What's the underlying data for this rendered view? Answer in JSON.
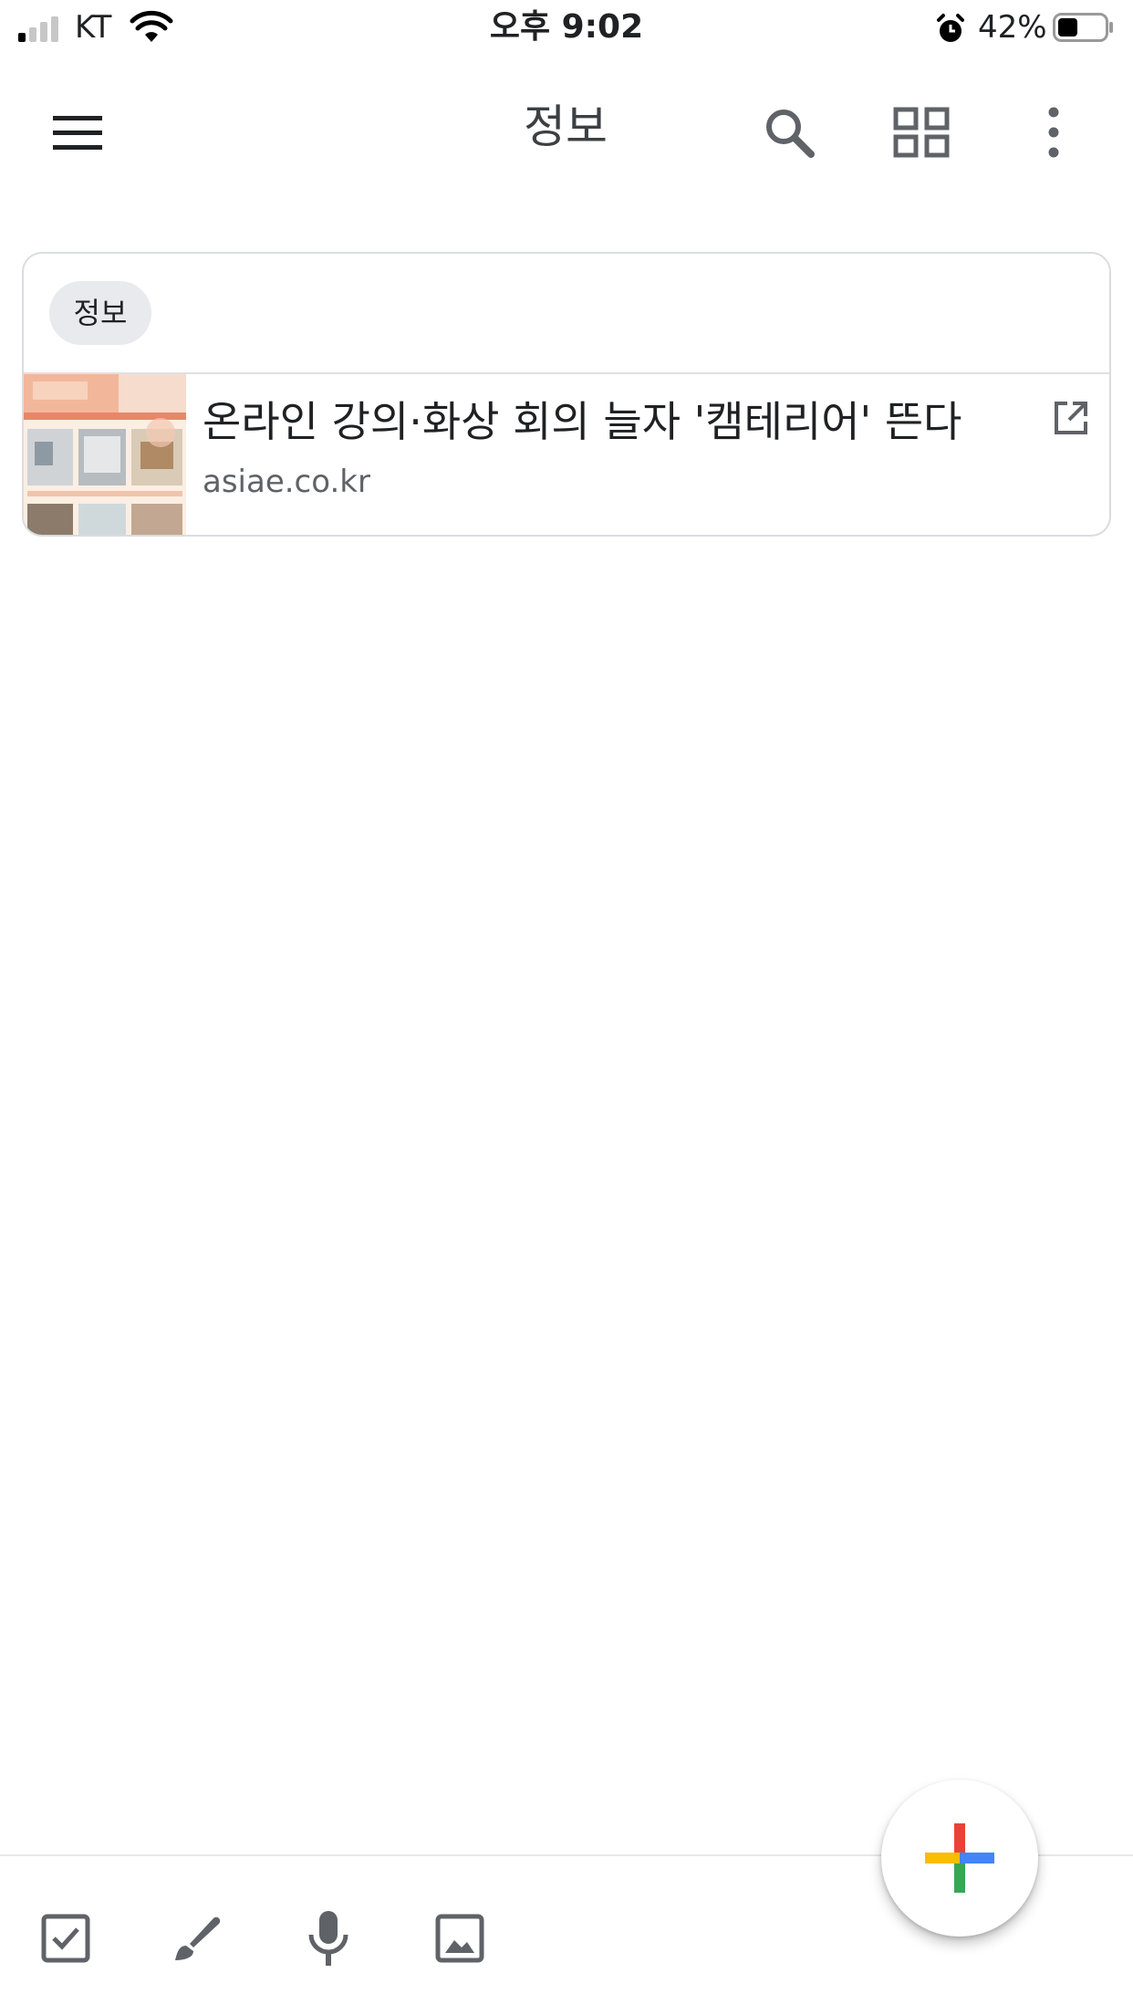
{
  "status_bar": {
    "carrier": "KT",
    "time": "오후 9:02",
    "battery_percent": "42%",
    "battery_level": 0.42,
    "icons": [
      "signal-icon",
      "wifi-icon",
      "alarm-icon",
      "battery-icon"
    ]
  },
  "toolbar": {
    "title": "정보",
    "icons": [
      "menu-icon",
      "search-icon",
      "grid-view-icon",
      "more-vert-icon"
    ]
  },
  "note": {
    "label": "정보",
    "link": {
      "title": "온라인 강의·화상 회의 늘자 '캠테리어' 뜬다",
      "domain": "asiae.co.kr",
      "thumbnail_icon": "article-thumbnail",
      "open_icon": "open-in-new-icon"
    }
  },
  "bottom_bar": {
    "icons": [
      "checkbox-icon",
      "brush-icon",
      "mic-icon",
      "image-icon"
    ]
  },
  "fab": {
    "icon": "plus-icon",
    "colors": {
      "red": "#ea4335",
      "blue": "#4285f4",
      "green": "#34a853",
      "yellow": "#fbbc04"
    }
  }
}
